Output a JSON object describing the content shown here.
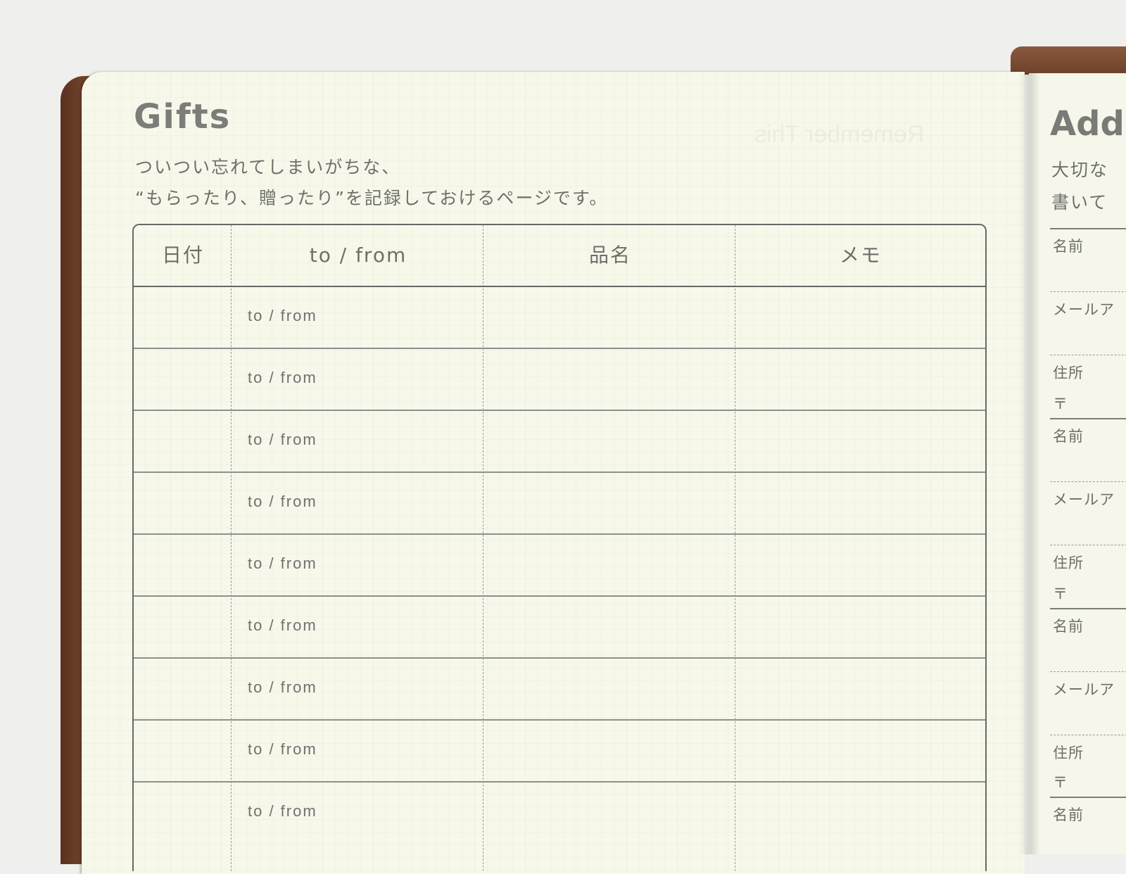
{
  "gifts": {
    "title": "Gifts",
    "subtitle_line1": "ついつい忘れてしまいがちな、",
    "subtitle_line2": "“もらったり、贈ったり”を記録しておけるページです。",
    "ghost_text": "Remember This",
    "table": {
      "headers": [
        "日付",
        "to  /  from",
        "品名",
        "メモ"
      ],
      "rows": [
        {
          "to_from": "to  /  from"
        },
        {
          "to_from": "to  /  from"
        },
        {
          "to_from": "to  /  from"
        },
        {
          "to_from": "to  /  from"
        },
        {
          "to_from": "to  /  from"
        },
        {
          "to_from": "to  /  from"
        },
        {
          "to_from": "to  /  from"
        },
        {
          "to_from": "to  /  from"
        },
        {
          "to_from": "to  /  from"
        }
      ]
    }
  },
  "address_page": {
    "title": "Add",
    "subtitle_line1": "大切な",
    "subtitle_line2": "書いて",
    "labels": [
      "名前",
      "メールア",
      "住所",
      "〒",
      "名前",
      "メールア",
      "住所",
      "〒",
      "名前",
      "メールア",
      "住所",
      "〒",
      "名前"
    ]
  },
  "colors": {
    "paper": "#f7f8ea",
    "cover_brown": "#6c4029",
    "ink_gray": "#6e6e6a"
  }
}
